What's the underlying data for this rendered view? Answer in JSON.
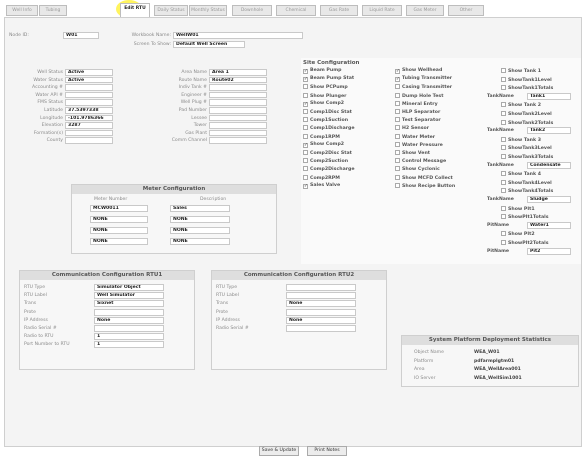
{
  "tabs": [
    "Well Info",
    "Tubing",
    "Edit RTU",
    "Daily Status",
    "Monthly Status",
    "Downhole",
    "Chemical",
    "Gas Rate",
    "Liquid Rate",
    "Gas Meter",
    "Other"
  ],
  "active_tab_index": 2,
  "top": {
    "node_id_label": "Node ID:",
    "node_id_value": "W01",
    "workbook_name_label": "Workbook Name:",
    "workbook_name_value": "WellW01",
    "screen_label": "Screen To Show:",
    "screen_value": "Default Well Screen"
  },
  "left_fields": [
    {
      "label": "Well Status",
      "value": "Active"
    },
    {
      "label": "Water Status",
      "value": "Active"
    },
    {
      "label": "Accounting #",
      "value": ""
    },
    {
      "label": "Water API #",
      "value": ""
    },
    {
      "label": "FMS Status",
      "value": ""
    },
    {
      "label": "Latitude",
      "value": "37.5397338"
    },
    {
      "label": "Longitude",
      "value": "-101.9786366"
    },
    {
      "label": "Elevation",
      "value": "3287"
    },
    {
      "label": "Formation(s)",
      "value": ""
    },
    {
      "label": "County",
      "value": ""
    }
  ],
  "mid_fields": [
    {
      "label": "Area Name",
      "value": "Area 1"
    },
    {
      "label": "Route Name",
      "value": "Route02"
    },
    {
      "label": "Indiv Tank #",
      "value": ""
    },
    {
      "label": "Engineer #",
      "value": ""
    },
    {
      "label": "Well Plug #",
      "value": ""
    },
    {
      "label": "Pad Number",
      "value": ""
    },
    {
      "label": "Lessee",
      "value": ""
    },
    {
      "label": "Tower",
      "value": ""
    },
    {
      "label": "Gas Plant",
      "value": ""
    },
    {
      "label": "Comm Channel",
      "value": ""
    }
  ],
  "site_config": {
    "title": "Site Configuration",
    "col1": [
      {
        "label": "Beam Pump",
        "checked": true
      },
      {
        "label": "Beam Pump Stat",
        "checked": true
      },
      {
        "label": "Show PCPump",
        "checked": false
      },
      {
        "label": "Show Plunger",
        "checked": false
      },
      {
        "label": "Show Comp2",
        "checked": true
      },
      {
        "label": "Comp1Disc Stat",
        "checked": false
      },
      {
        "label": "Comp1Suction",
        "checked": false
      },
      {
        "label": "Comp1Discharge",
        "checked": false
      },
      {
        "label": "Comp1RPM",
        "checked": false
      },
      {
        "label": "Show Comp2",
        "checked": true
      },
      {
        "label": "Comp2Disc Stat",
        "checked": false
      },
      {
        "label": "Comp2Suction",
        "checked": false
      },
      {
        "label": "Comp2Discharge",
        "checked": false
      },
      {
        "label": "Comp2RPM",
        "checked": false
      },
      {
        "label": "Sales Valve",
        "checked": true
      }
    ],
    "col2": [
      {
        "label": "Show Wellhead",
        "checked": true
      },
      {
        "label": "Tubing Transmitter",
        "checked": true
      },
      {
        "label": "Casing Transmitter",
        "checked": false
      },
      {
        "label": "Dump Hole Test",
        "checked": false
      },
      {
        "label": "Mineral Entry",
        "checked": false
      },
      {
        "label": "HLP Separator",
        "checked": false
      },
      {
        "label": "Test Separator",
        "checked": false
      },
      {
        "label": "H2 Sensor",
        "checked": false
      },
      {
        "label": "Water Meter",
        "checked": false
      },
      {
        "label": "Water Pressure",
        "checked": false
      },
      {
        "label": "Show Vent",
        "checked": false
      },
      {
        "label": "Control Message",
        "checked": false
      },
      {
        "label": "Show Cyclonic",
        "checked": false
      },
      {
        "label": "Show MCFD Collect",
        "checked": false
      },
      {
        "label": "Show Recipe Button",
        "checked": false
      }
    ],
    "col3": [
      {
        "kind": "chk",
        "label": "Show Tank 1"
      },
      {
        "kind": "chk",
        "label": "ShowTank1Level"
      },
      {
        "kind": "chk",
        "label": "ShowTank1Totals"
      },
      {
        "kind": "name",
        "label": "TankName",
        "value": "Tank1"
      },
      {
        "kind": "chk",
        "label": "Show Tank 2"
      },
      {
        "kind": "chk",
        "label": "ShowTank2Level"
      },
      {
        "kind": "chk",
        "label": "ShowTank2Totals"
      },
      {
        "kind": "name",
        "label": "TankName",
        "value": "Tank2"
      },
      {
        "kind": "chk",
        "label": "Show Tank 3"
      },
      {
        "kind": "chk",
        "label": "ShowTank3Level"
      },
      {
        "kind": "chk",
        "label": "ShowTank3Totals"
      },
      {
        "kind": "name",
        "label": "TankName",
        "value": "Condensate"
      },
      {
        "kind": "chk",
        "label": "Show Tank 4"
      },
      {
        "kind": "chk",
        "label": "ShowTank4Level"
      },
      {
        "kind": "chk",
        "label": "ShowTank4Totals"
      },
      {
        "kind": "name",
        "label": "TankName",
        "value": "Sludge"
      },
      {
        "kind": "chk",
        "label": "Show PIt1"
      },
      {
        "kind": "chk",
        "label": "ShowPIt1Totals"
      },
      {
        "kind": "name",
        "label": "PitName",
        "value": "Water1"
      },
      {
        "kind": "chk",
        "label": "Show PIt2"
      },
      {
        "kind": "chk",
        "label": "ShowPIt2Totals"
      },
      {
        "kind": "name",
        "label": "PitName",
        "value": "Pit2"
      }
    ]
  },
  "meter_config": {
    "title": "Meter Configuration",
    "col_meter": "Meter Number",
    "col_desc": "Description",
    "rows": [
      {
        "meter": "MCW0011",
        "desc": "Sales"
      },
      {
        "meter": "NONE",
        "desc": "NONE"
      },
      {
        "meter": "NONE",
        "desc": "NONE"
      },
      {
        "meter": "NONE",
        "desc": "NONE"
      }
    ]
  },
  "comm1": {
    "title": "Communication Configuration RTU1",
    "rows": [
      {
        "label": "RTU Type",
        "value": "Simulator Object"
      },
      {
        "label": "RTU Label",
        "value": "Well Simulator"
      },
      {
        "label": "Trans",
        "value": "Sixnet"
      },
      {
        "label": "Prote",
        "value": ""
      },
      {
        "label": "IP Address",
        "value": "None"
      },
      {
        "label": "Radio Serial #",
        "value": ""
      },
      {
        "label": "Radio to RTU",
        "value": "1"
      },
      {
        "label": "Port Number to RTU",
        "value": "1"
      }
    ]
  },
  "comm2": {
    "title": "Communication Configuration RTU2",
    "rows": [
      {
        "label": "RTU Type",
        "value": ""
      },
      {
        "label": "RTU Label",
        "value": ""
      },
      {
        "label": "Trans",
        "value": "None"
      },
      {
        "label": "Prote",
        "value": ""
      },
      {
        "label": "IP Address",
        "value": "None"
      },
      {
        "label": "Radio Serial #",
        "value": ""
      }
    ]
  },
  "deployment": {
    "title": "System Platform Deployment Statistics",
    "rows": [
      {
        "label": "Object Name",
        "value": "WEA_W01"
      },
      {
        "label": "Platform",
        "value": "pdfarmplgtm01"
      },
      {
        "label": "Area",
        "value": "WEA_WellArea001"
      },
      {
        "label": "IO Server",
        "value": "WEA_WellSim1001"
      }
    ]
  },
  "buttons": {
    "save": "Save & Update",
    "print": "Print Notes"
  }
}
